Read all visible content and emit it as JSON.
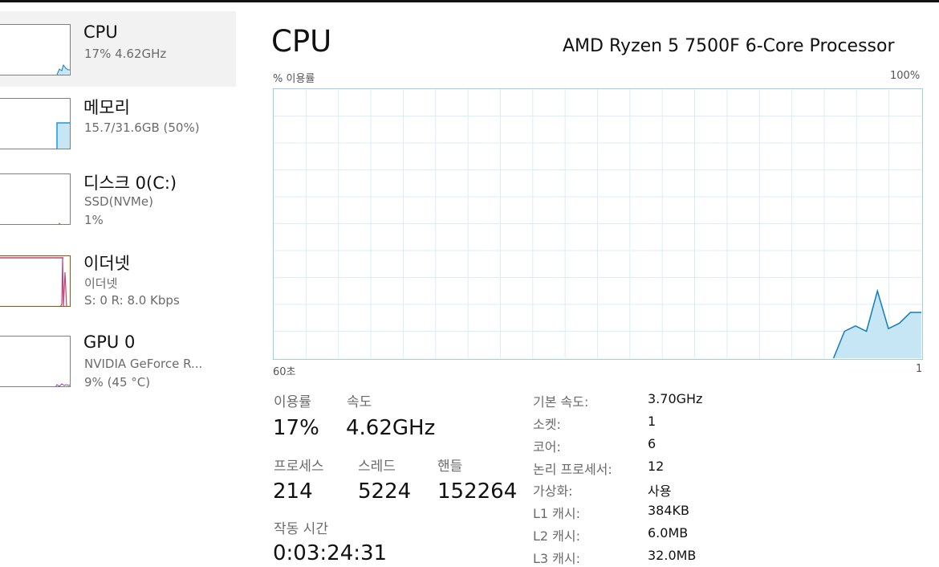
{
  "sidebar": {
    "items": [
      {
        "title": "CPU",
        "line1": "17% 4.62GHz",
        "line2": "",
        "color": "#117dbb"
      },
      {
        "title": "메모리",
        "line1": "15.7/31.6GB (50%)",
        "line2": "",
        "color": "#139ae0"
      },
      {
        "title": "디스크 0(C:)",
        "line1": "SSD(NVMe)",
        "line2": "1%",
        "color": "#4da60c"
      },
      {
        "title": "이더넷",
        "line1": "이더넷",
        "line2": "S: 0 R: 8.0 Kbps",
        "color": "#a74f01"
      },
      {
        "title": "GPU 0",
        "line1": "NVIDIA GeForce R...",
        "line2": "9% (45 °C)",
        "color": "#8e3fbf"
      }
    ]
  },
  "main": {
    "title": "CPU",
    "processor": "AMD Ryzen 5 7500F 6-Core Processor",
    "graph": {
      "y_label": "% 이용률",
      "y_max_label": "100%",
      "x_left_label": "60초",
      "x_right_label": "1",
      "line_color": "#117dbb",
      "fill_color": "#c6e6f6",
      "grid_color": "#d9eef8"
    },
    "stats": {
      "utilization_label": "이용률",
      "utilization_value": "17%",
      "speed_label": "속도",
      "speed_value": "4.62GHz",
      "processes_label": "프로세스",
      "processes_value": "214",
      "threads_label": "스레드",
      "threads_value": "5224",
      "handles_label": "핸들",
      "handles_value": "152264",
      "uptime_label": "작동 시간",
      "uptime_value": "0:03:24:31"
    },
    "specs": [
      {
        "label": "기본 속도:",
        "value": "3.70GHz"
      },
      {
        "label": "소켓:",
        "value": "1"
      },
      {
        "label": "코어:",
        "value": "6"
      },
      {
        "label": "논리 프로세서:",
        "value": "12"
      },
      {
        "label": "가상화:",
        "value": "사용"
      },
      {
        "label": "L1 캐시:",
        "value": "384KB"
      },
      {
        "label": "L2 캐시:",
        "value": "6.0MB"
      },
      {
        "label": "L3 캐시:",
        "value": "32.0MB"
      }
    ]
  },
  "chart_data": {
    "type": "area",
    "x": [
      60,
      59,
      58,
      57,
      56,
      55,
      54,
      53,
      52,
      51,
      50,
      49,
      48,
      47,
      46,
      45,
      44,
      43,
      42,
      41,
      40,
      39,
      38,
      37,
      36,
      35,
      34,
      33,
      32,
      31,
      30,
      29,
      28,
      27,
      26,
      25,
      24,
      23,
      22,
      21,
      20,
      19,
      18,
      17,
      16,
      15,
      14,
      13,
      12,
      11,
      10,
      9,
      8,
      7,
      6,
      5,
      4,
      3,
      2,
      1
    ],
    "values": [
      0,
      0,
      0,
      0,
      0,
      0,
      0,
      0,
      0,
      0,
      0,
      0,
      0,
      0,
      0,
      0,
      0,
      0,
      0,
      0,
      0,
      0,
      0,
      0,
      0,
      0,
      0,
      0,
      0,
      0,
      0,
      0,
      0,
      0,
      0,
      0,
      0,
      0,
      0,
      0,
      0,
      0,
      0,
      0,
      0,
      0,
      0,
      0,
      0,
      0,
      0,
      0,
      10,
      12,
      10,
      25,
      11,
      13,
      17,
      17
    ],
    "xlabel": "60초",
    "ylabel": "% 이용률",
    "ylim": [
      0,
      100
    ]
  }
}
